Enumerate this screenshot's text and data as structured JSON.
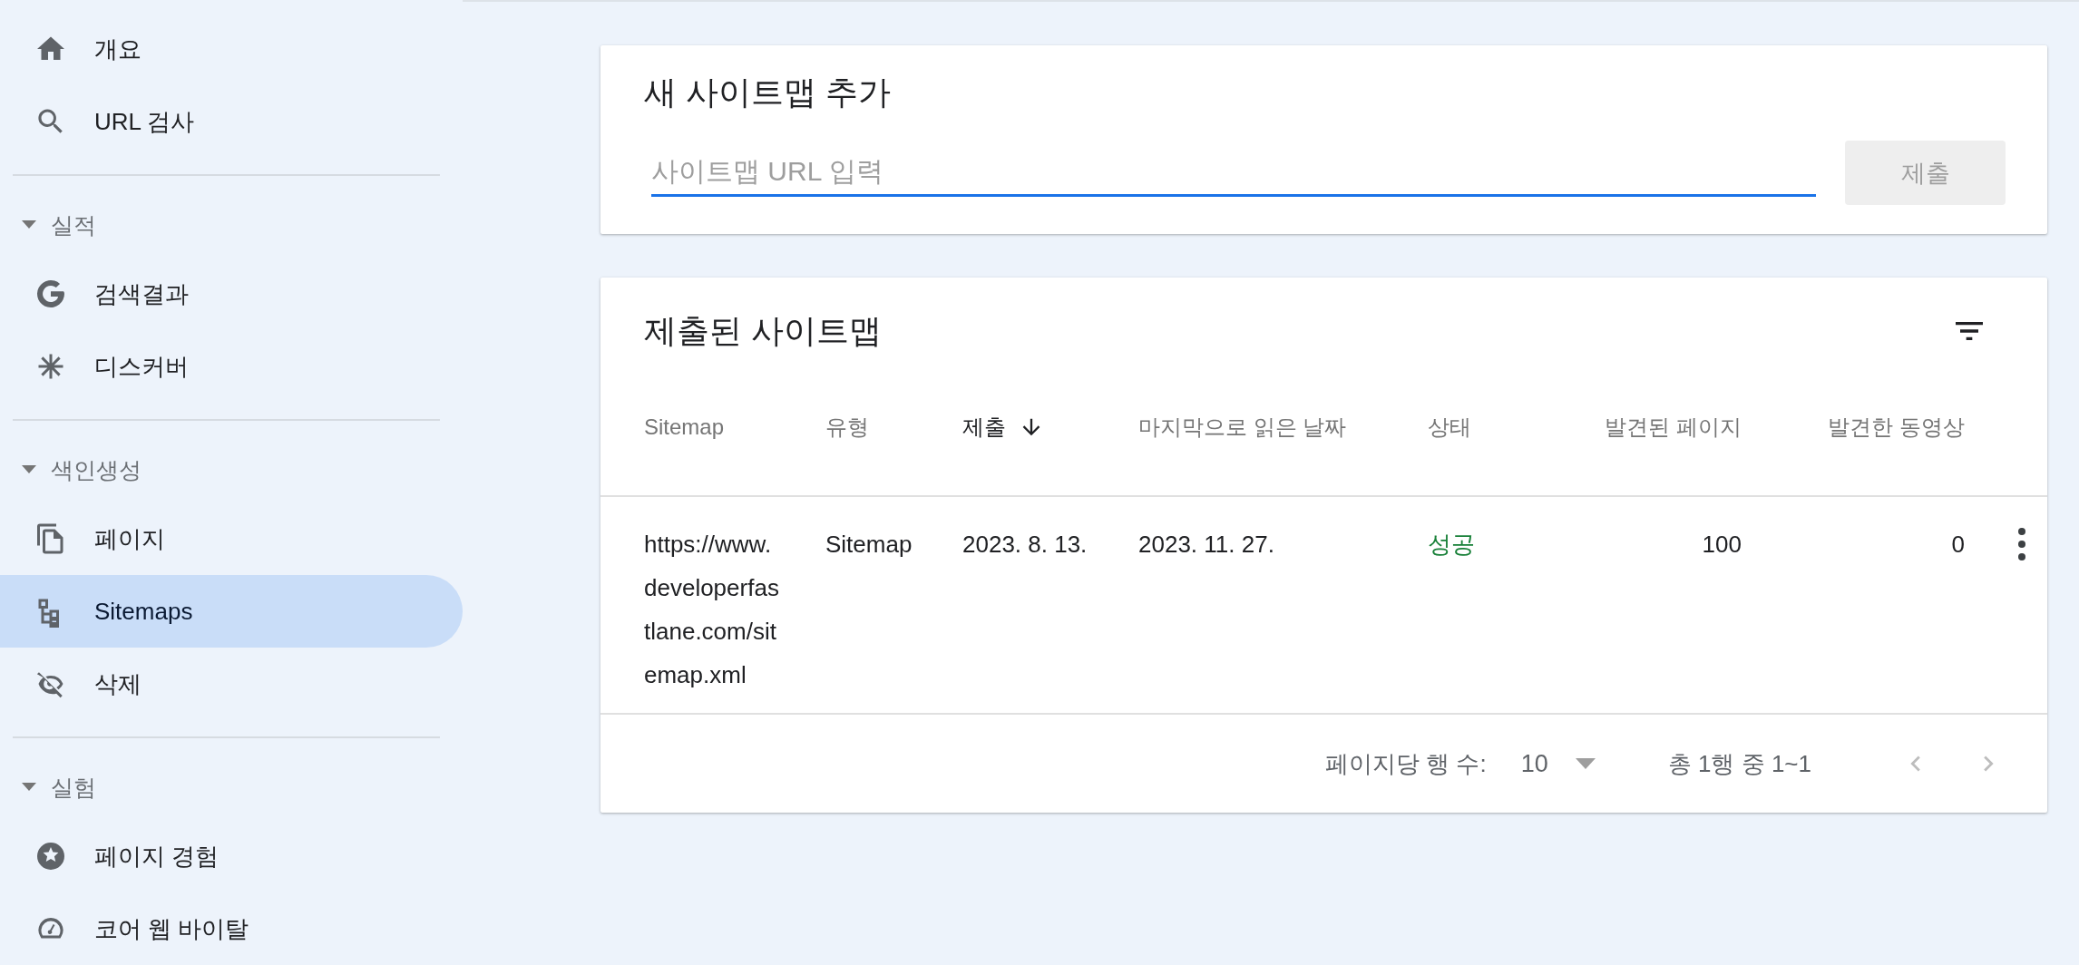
{
  "sidebar": {
    "items": [
      {
        "label": "개요",
        "selected": false
      },
      {
        "label": "URL 검사",
        "selected": false
      }
    ],
    "sections": [
      {
        "title": "실적",
        "expanded": true,
        "items": [
          {
            "label": "검색결과",
            "selected": false
          },
          {
            "label": "디스커버",
            "selected": false
          }
        ]
      },
      {
        "title": "색인생성",
        "expanded": true,
        "items": [
          {
            "label": "페이지",
            "selected": false
          },
          {
            "label": "Sitemaps",
            "selected": true
          },
          {
            "label": "삭제",
            "selected": false
          }
        ]
      },
      {
        "title": "실험",
        "expanded": true,
        "items": [
          {
            "label": "페이지 경험",
            "selected": false
          },
          {
            "label": "코어 웹 바이탈",
            "selected": false
          }
        ]
      }
    ]
  },
  "add_card": {
    "title": "새 사이트맵 추가",
    "input": {
      "placeholder": "사이트맵 URL 입력",
      "focused": true
    },
    "submit": {
      "label": "제출",
      "disabled": true
    }
  },
  "submitted_card": {
    "title": "제출된 사이트맵",
    "table": {
      "columns": [
        {
          "label": "Sitemap",
          "sorted": false
        },
        {
          "label": "유형",
          "sorted": false
        },
        {
          "label": "제출",
          "sorted": true
        },
        {
          "label": "마지막으로 읽은 날짜",
          "sorted": false
        },
        {
          "label": "상태",
          "sorted": false
        },
        {
          "label": "발견된 페이지",
          "sorted": false
        },
        {
          "label": "발견한 동영상",
          "sorted": false
        }
      ],
      "rows": [
        {
          "cells": [
            "https://www.developerfastlane.com/sitemap.xml",
            "Sitemap",
            "2023. 8. 13.",
            "2023. 11. 27.",
            "성공",
            "100",
            "0"
          ]
        }
      ]
    },
    "pagination": {
      "rows_per_page_label": "페이지당 행 수:",
      "rows_per_page": "10",
      "range": "총 1행 중 1~1",
      "prev_disabled": true,
      "next_disabled": true
    }
  }
}
